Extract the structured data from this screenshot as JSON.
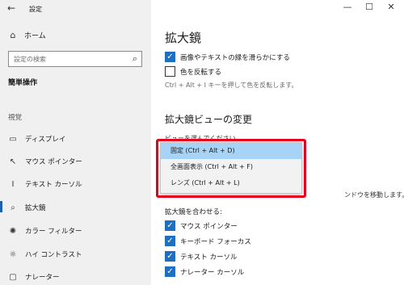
{
  "window": {
    "title": "設定",
    "back_icon": "arrow-left-icon",
    "controls": [
      "minimize-icon",
      "maximize-icon",
      "close-icon"
    ]
  },
  "sidebar": {
    "home_label": "ホーム",
    "search_placeholder": "設定の検索",
    "section_title": "簡単操作",
    "group_label": "視覚",
    "items": [
      {
        "label": "ディスプレイ",
        "icon": "display-icon"
      },
      {
        "label": "マウス ポインター",
        "icon": "mouse-pointer-icon"
      },
      {
        "label": "テキスト カーソル",
        "icon": "text-cursor-icon"
      },
      {
        "label": "拡大鏡",
        "icon": "magnifier-icon",
        "selected": true
      },
      {
        "label": "カラー フィルター",
        "icon": "color-filter-icon"
      },
      {
        "label": "ハイ コントラスト",
        "icon": "high-contrast-icon"
      },
      {
        "label": "ナレーター",
        "icon": "narrator-icon"
      }
    ]
  },
  "main": {
    "title": "拡大鏡",
    "smooth_label": "画像やテキストの縁を滑らかにする",
    "smooth_checked": true,
    "invert_label": "色を反転する",
    "invert_checked": false,
    "invert_hint": "Ctrl + Alt + I キーを押して色を反転します。",
    "view_title": "拡大鏡ビューの変更",
    "view_label": "ビューを選んでください",
    "background_hint": "ンドウを移動します。",
    "follow_label": "拡大鏡を合わせる:",
    "follow_items": [
      {
        "label": "マウス ポインター",
        "checked": true
      },
      {
        "label": "キーボード フォーカス",
        "checked": true
      },
      {
        "label": "テキスト カーソル",
        "checked": true
      },
      {
        "label": "ナレーター カーソル",
        "checked": true
      }
    ]
  },
  "dropdown": {
    "options": [
      {
        "label": "固定 (Ctrl + Alt + D)",
        "selected": true
      },
      {
        "label": "全画面表示 (Ctrl + Alt + F)",
        "selected": false
      },
      {
        "label": "レンズ (Ctrl + Alt + L)",
        "selected": false
      }
    ],
    "highlight_color": "#e3001b",
    "selected_color": "#a7d3f6"
  },
  "colors": {
    "accent": "#1f6fc0",
    "sidebar_bg": "#f0f0f0"
  }
}
